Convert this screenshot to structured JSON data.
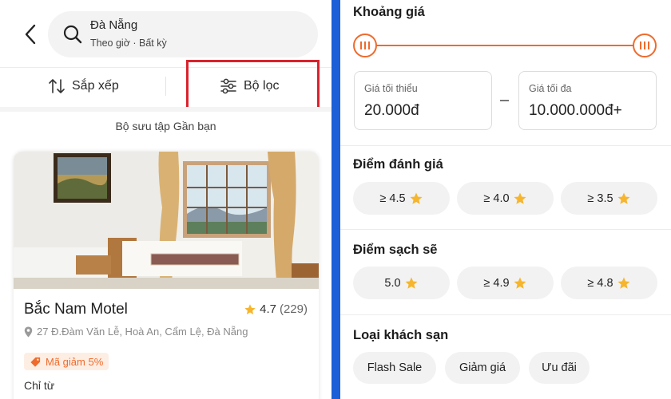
{
  "search": {
    "location": "Đà Nẵng",
    "subtitle": "Theo giờ · Bất kỳ"
  },
  "toolbar": {
    "sort_label": "Sắp xếp",
    "filter_label": "Bộ lọc"
  },
  "collection": {
    "title": "Bộ sưu tập Gần bạn"
  },
  "hotel": {
    "name": "Bắc Nam Motel",
    "rating": "4.7",
    "review_count": "(229)",
    "address": "27 Đ.Đàm Văn Lễ, Hoà An, Cẩm Lệ, Đà Nẵng",
    "discount": "Mã giảm 5%",
    "price_label": "Chỉ từ"
  },
  "filters": {
    "price": {
      "title": "Khoảng giá",
      "min_label": "Giá tối thiểu",
      "min_value": "20.000đ",
      "max_label": "Giá tối đa",
      "max_value": "10.000.000đ+"
    },
    "rating": {
      "title": "Điểm đánh giá",
      "options": [
        "≥ 4.5",
        "≥ 4.0",
        "≥ 3.5"
      ]
    },
    "cleanliness": {
      "title": "Điểm sạch sẽ",
      "options": [
        "5.0",
        "≥ 4.9",
        "≥ 4.8"
      ]
    },
    "hotel_type": {
      "title": "Loại khách sạn",
      "options": [
        "Flash Sale",
        "Giảm giá",
        "Ưu đãi"
      ]
    }
  },
  "colors": {
    "accent": "#ef6b2c",
    "star": "#f6b52c",
    "highlight": "#d9232d",
    "divider": "#1c5fd6"
  }
}
